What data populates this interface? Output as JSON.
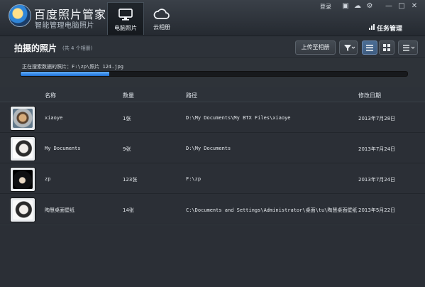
{
  "app": {
    "title": "百度照片管家",
    "subtitle": "智能管理电脑照片",
    "tabs": [
      {
        "label": "电脑照片",
        "icon": "monitor-icon"
      },
      {
        "label": "云相册",
        "icon": "cloud-icon"
      }
    ],
    "top_actions": {
      "login": "登录",
      "icons": [
        "message-icon",
        "cloud-sync-icon",
        "settings-icon",
        "minimize-icon",
        "maximize-icon",
        "close-icon"
      ]
    },
    "task_manager": "任务管理"
  },
  "toolbar": {
    "title": "拍摄的照片",
    "count": "(共 4 个相册)",
    "upload": "上传至相册",
    "filter_icon": "filter-icon",
    "view_icons": [
      "list-view-icon",
      "grid-view-icon",
      "menu-icon"
    ]
  },
  "status": {
    "text": "正在搜索数据的照片：F:\\zp\\照片 124.jpg",
    "progress": 0.23
  },
  "table": {
    "headers": [
      "名称",
      "数量",
      "路径",
      "修改日期"
    ],
    "rows": [
      {
        "name": "xiaoye",
        "count": "1张",
        "path": "D:\\My Documents\\My BTX Files\\xiaoye",
        "date": "2013年7月28日"
      },
      {
        "name": "My Documents",
        "count": "9张",
        "path": "D:\\My Documents",
        "date": "2013年7月24日"
      },
      {
        "name": "zp",
        "count": "123张",
        "path": "F:\\zp",
        "date": "2013年7月24日"
      },
      {
        "name": "陶慧桌面壁纸",
        "count": "14张",
        "path": "C:\\Documents  and Settings\\Administrator\\桌面\\tu\\陶慧桌面壁纸",
        "date": "2013年5月22日"
      }
    ]
  },
  "colors": {
    "accent": "#1d6fd2",
    "background": "#2b2f36"
  }
}
